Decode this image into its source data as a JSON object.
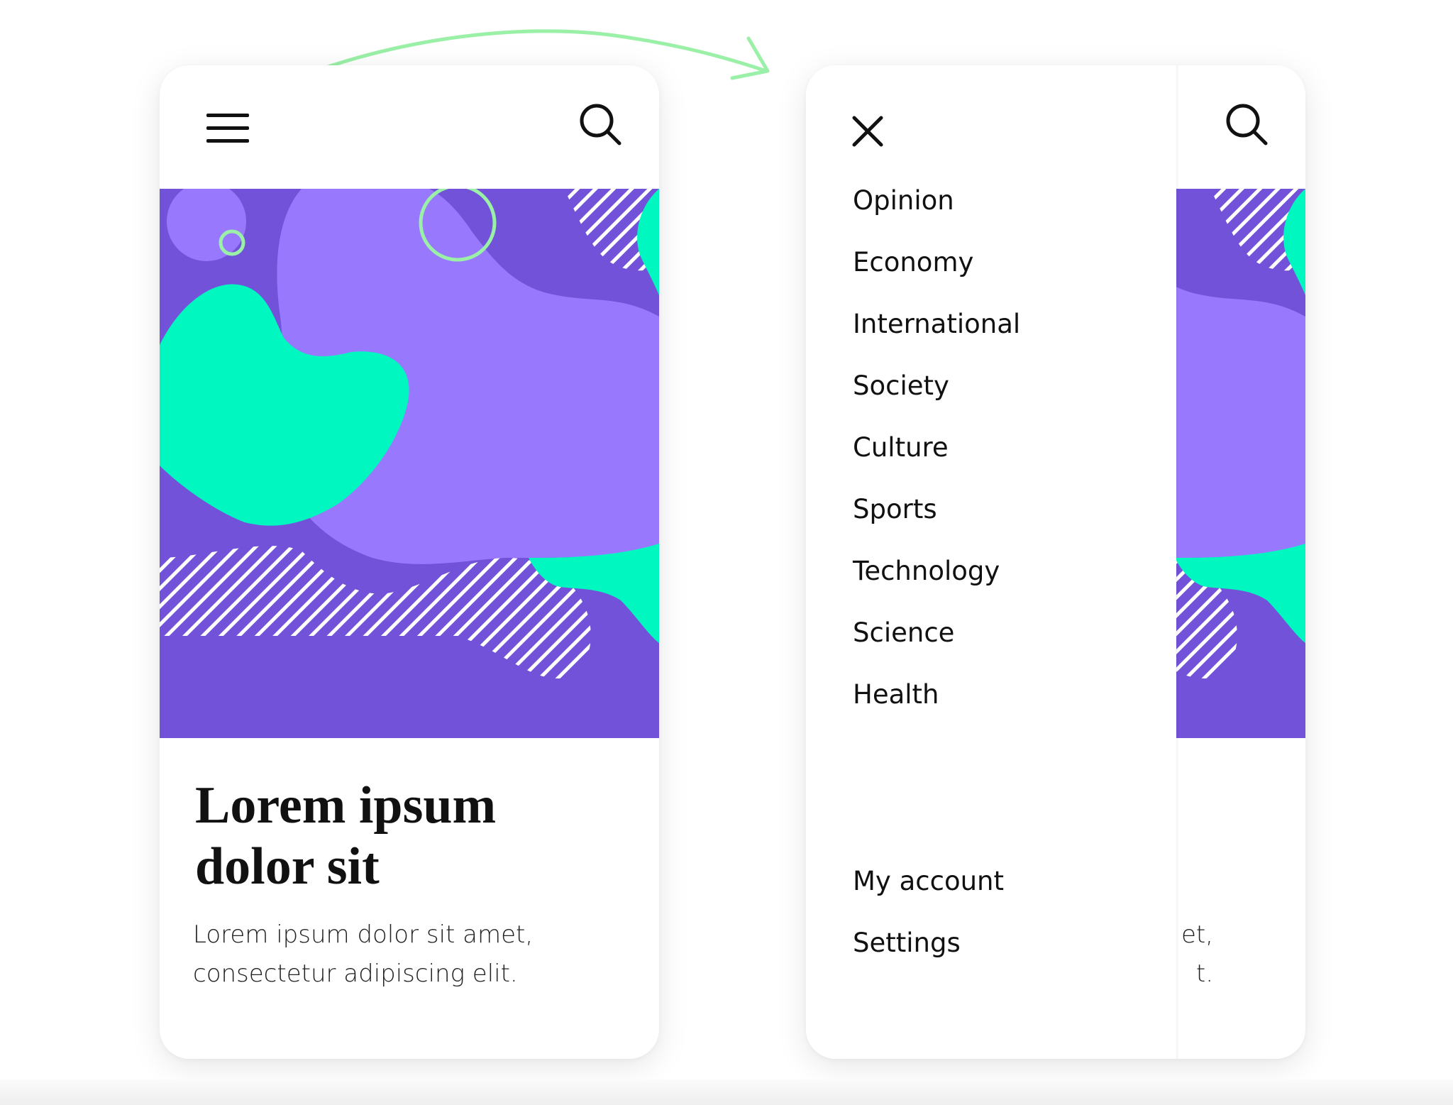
{
  "colors": {
    "purple_dark": "#7152d8",
    "purple_light": "#9879fe",
    "mint": "#00f7c0",
    "annotation_green": "#9af0a6",
    "text": "#111111"
  },
  "left_screen": {
    "header": {
      "menu_icon": "hamburger-menu-icon",
      "search_icon": "search-icon"
    },
    "article": {
      "title_line1": "Lorem ipsum",
      "title_line2": "dolor sit",
      "summary_line1": "Lorem ipsum dolor sit amet,",
      "summary_line2": "consectetur adipiscing elit."
    }
  },
  "right_screen": {
    "drawer": {
      "close_icon": "close-icon",
      "menu_items": [
        "Opinion",
        "Economy",
        "International",
        "Society",
        "Culture",
        "Sports",
        "Technology",
        "Science",
        "Health"
      ],
      "account_items": [
        "My account",
        "Settings"
      ]
    },
    "peek": {
      "search_icon": "search-icon",
      "summary_line1": "et,",
      "summary_line2": "t."
    }
  }
}
